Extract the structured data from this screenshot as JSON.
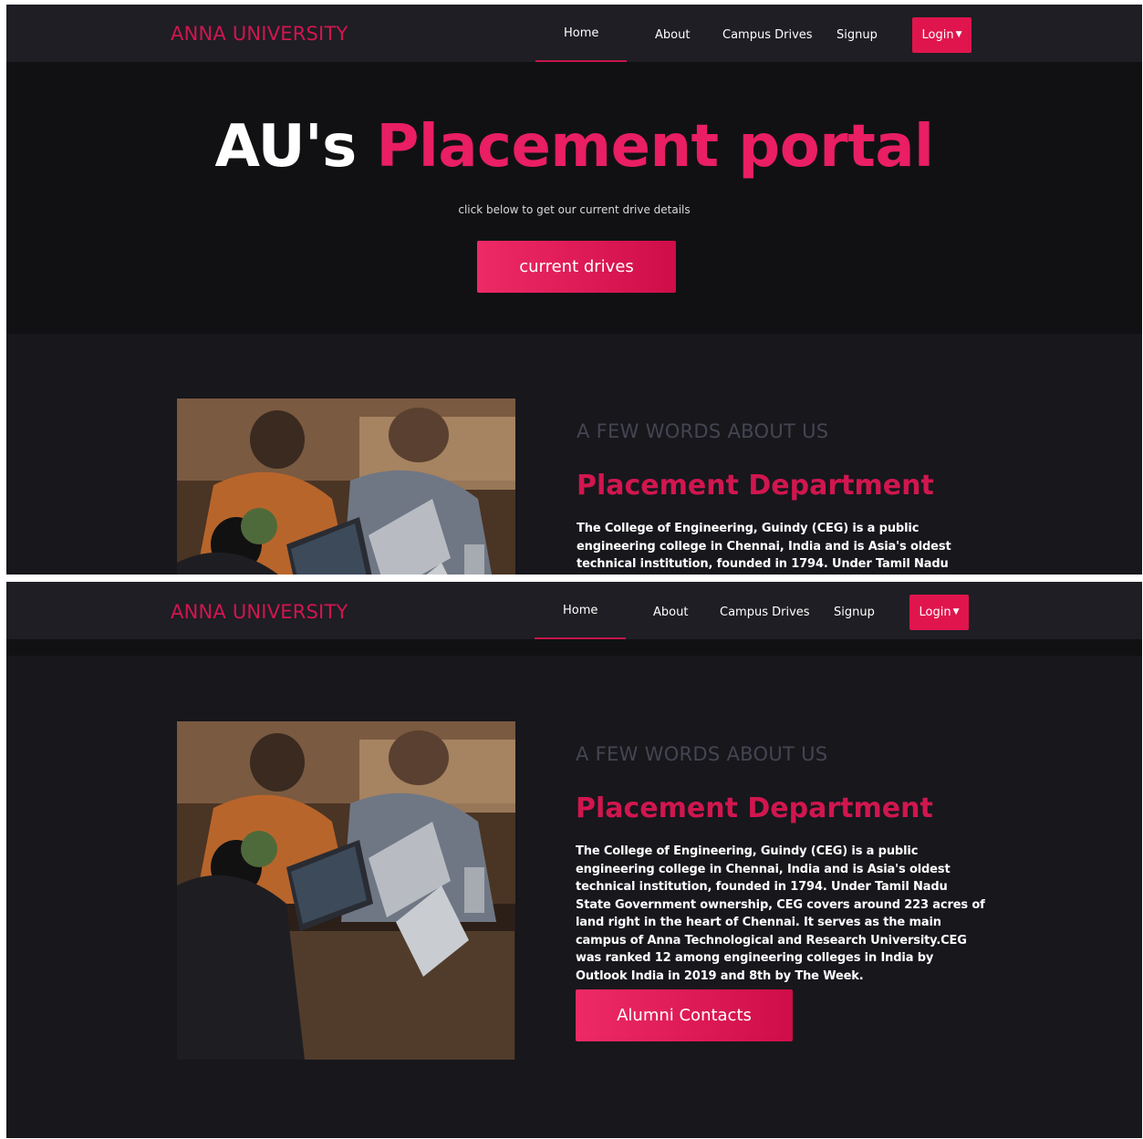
{
  "navbar": {
    "brand": "ANNA UNIVERSITY",
    "links": [
      {
        "label": "Home"
      },
      {
        "label": "About"
      },
      {
        "label": "Campus Drives"
      },
      {
        "label": "Signup"
      }
    ],
    "login_label": "Login"
  },
  "hero": {
    "title_white": "AU's ",
    "title_accent": "Placement portal",
    "subtitle": "click below to get our current drive details",
    "button_label": "current drives"
  },
  "about": {
    "eyebrow": "A FEW WORDS ABOUT US",
    "title": "Placement Department",
    "text": "The College of Engineering, Guindy (CEG) is a public engineering college in Chennai, India and is Asia's oldest technical institution, founded in 1794. Under Tamil Nadu State Government ownership, CEG covers around 223 acres of land right in the heart of Chennai. It serves as the main campus of Anna Technological and Research University.CEG was ranked 12 among engineering colleges in India by Outlook India in 2019 and 8th by The Week.",
    "button_label": "Alumni Contacts"
  },
  "colors": {
    "accent": "#e91e63",
    "brand": "#d1164f",
    "background": "#17171c",
    "navbar": "#1e1e24",
    "hero": "#111114"
  },
  "icons": {
    "login_caret": "caret-down-icon"
  }
}
